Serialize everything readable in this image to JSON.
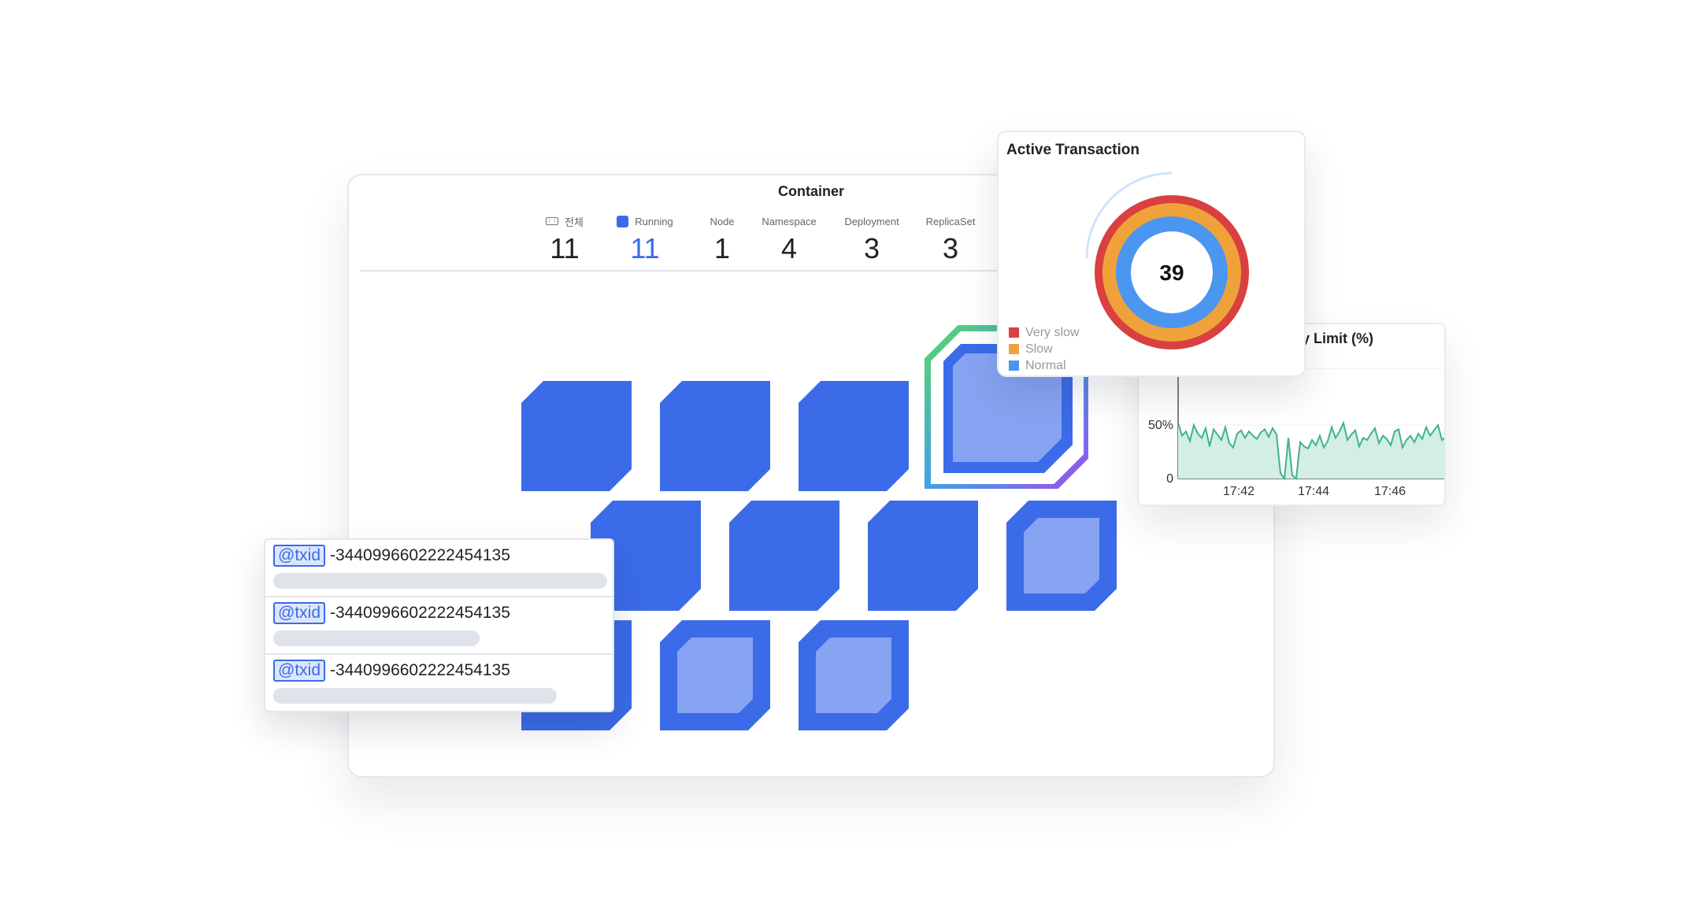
{
  "container": {
    "title": "Container",
    "stats": [
      {
        "label": "전체",
        "value": "11",
        "icon": "grid-icon"
      },
      {
        "label": "Running",
        "value": "11",
        "icon": "running-square-icon"
      },
      {
        "label": "Node",
        "value": "1"
      },
      {
        "label": "Namespace",
        "value": "4"
      },
      {
        "label": "Deployment",
        "value": "3"
      },
      {
        "label": "ReplicaSet",
        "value": "3"
      }
    ],
    "colors": {
      "cell": "#3b6be8",
      "cell_inner": "#87a4f2"
    }
  },
  "active_transaction": {
    "title": "Active Transaction",
    "value": "39",
    "legend": [
      {
        "label": "Very slow",
        "color": "#d94040"
      },
      {
        "label": "Slow",
        "color": "#f0a23a"
      },
      {
        "label": "Normal",
        "color": "#4a96f0"
      }
    ]
  },
  "memory": {
    "title": "y Limit (%)",
    "chart_data": {
      "type": "area",
      "ylabel": "",
      "yticks": [
        "50%",
        "0"
      ],
      "xticks": [
        "17:42",
        "17:44",
        "17:46"
      ],
      "ylim": [
        0,
        100
      ],
      "values": [
        52,
        40,
        44,
        35,
        50,
        42,
        38,
        47,
        30,
        46,
        41,
        36,
        48,
        33,
        29,
        42,
        45,
        38,
        44,
        40,
        37,
        43,
        46,
        39,
        47,
        41,
        5,
        0,
        38,
        3,
        0,
        34,
        30,
        28,
        36,
        31,
        40,
        29,
        35,
        48,
        38,
        44,
        52,
        36,
        41,
        45,
        30,
        38,
        36,
        42,
        47,
        33,
        40,
        37,
        31,
        44,
        46,
        29,
        36,
        40,
        34,
        42,
        37,
        48,
        40,
        45,
        50,
        36,
        39
      ]
    },
    "colors": {
      "line": "#3fb488",
      "fill": "#d3eee3"
    }
  },
  "transactions": {
    "tag": "@txid",
    "rows": [
      {
        "id": "-3440996602222454135",
        "bar": 0.95
      },
      {
        "id": "-3440996602222454135",
        "bar": 0.59
      },
      {
        "id": "-3440996602222454135",
        "bar": 0.81
      }
    ]
  }
}
